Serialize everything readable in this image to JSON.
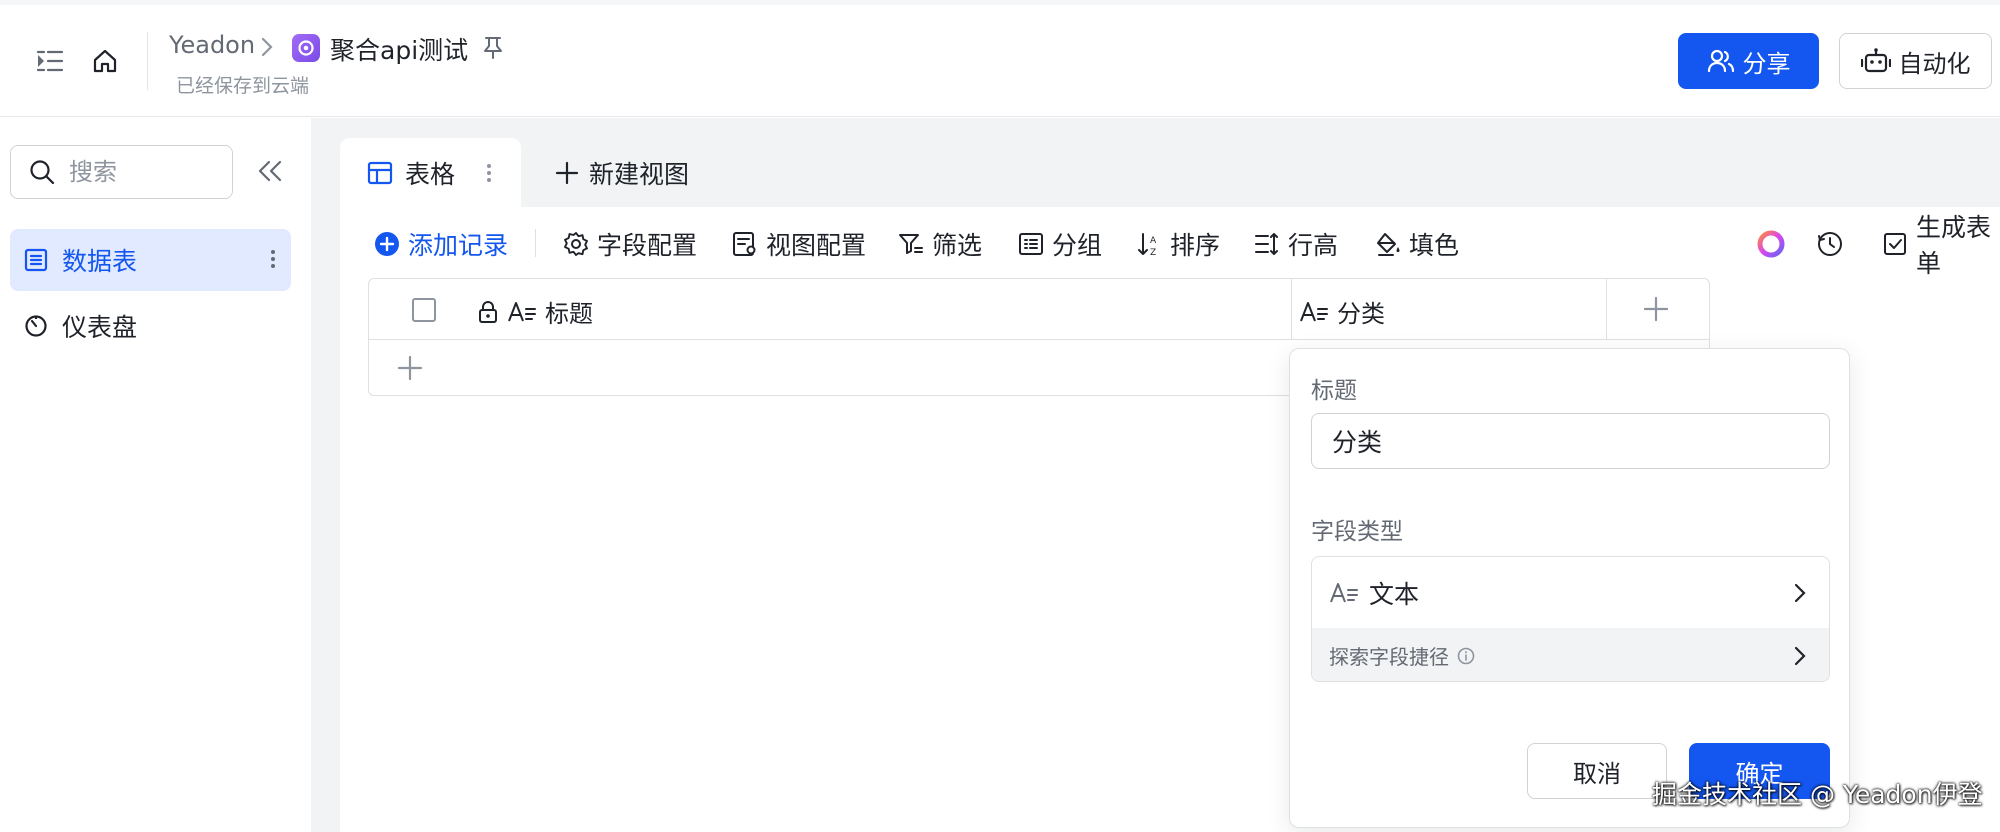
{
  "colors": {
    "primary": "#1456f0",
    "app_badge": "#8b5cf6",
    "nav_active_bg": "#e1eaff"
  },
  "header": {
    "icons": [
      "sidebar-toggle-icon",
      "home-icon",
      "pin-icon",
      "users-icon",
      "robot-icon"
    ],
    "owner": "Yeadon",
    "app_name": "聚合api测试",
    "saved_status": "已经保存到云端",
    "share_label": "分享",
    "automation_label": "自动化"
  },
  "sidebar": {
    "search_placeholder": "搜索",
    "items": [
      {
        "label": "数据表",
        "icon": "table-icon",
        "active": true
      },
      {
        "label": "仪表盘",
        "icon": "dashboard-icon",
        "active": false
      }
    ]
  },
  "views": {
    "tabs": [
      {
        "label": "表格",
        "icon": "grid-table-icon",
        "active": true
      }
    ],
    "new_view_label": "新建视图"
  },
  "toolbar": {
    "add_record": "添加记录",
    "field_config": "字段配置",
    "view_config": "视图配置",
    "filter": "筛选",
    "group": "分组",
    "sort": "排序",
    "row_height": "行高",
    "fill": "填色",
    "generate_form": "生成表单"
  },
  "grid": {
    "columns": [
      {
        "label": "标题",
        "icon": "text-field-icon",
        "locked": true
      },
      {
        "label": "分类",
        "icon": "text-field-icon",
        "locked": false
      }
    ],
    "rows": []
  },
  "field_popover": {
    "title_label": "标题",
    "title_value": "分类",
    "type_label": "字段类型",
    "type_value": "文本",
    "explore_label": "探索字段捷径",
    "cancel_label": "取消",
    "ok_label": "确定"
  },
  "watermark": "掘金技术社区 @ Yeadon伊登"
}
